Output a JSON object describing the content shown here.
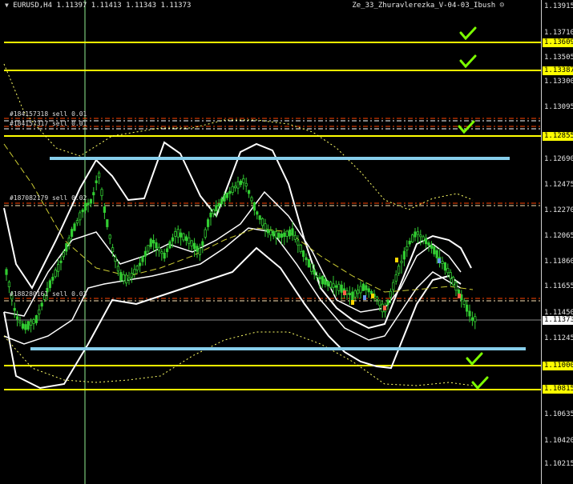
{
  "header": {
    "symbol": "EURUSD,H4",
    "quote": "1.11397 1.11413 1.11343 1.11373",
    "expert": "Ze_33_Zhuravlerezka_V-04-03_Ibush",
    "expert_icon": "smiley-icon"
  },
  "price_axis": {
    "ticks": [
      "1.13915",
      "1.13710",
      "1.13505",
      "1.13300",
      "1.13095",
      "1.12690",
      "1.12475",
      "1.12270",
      "1.12065",
      "1.11860",
      "1.11655",
      "1.11450",
      "1.11245",
      "1.10635",
      "1.10420",
      "1.10215"
    ],
    "level_tags": [
      "1.13609",
      "1.13387",
      "1.12855",
      "1.11000",
      "1.10815"
    ],
    "current_price": "1.11373"
  },
  "orders": [
    {
      "label": "#184157318 sell 0.01"
    },
    {
      "label": "#184157317 sell 0.01"
    },
    {
      "label": "#187082179 sell 0.02"
    },
    {
      "label": "#188280161 sell 0.03"
    }
  ],
  "colors": {
    "background": "#000000",
    "candles": "#32cd32",
    "levels": "#ffff00",
    "zone_lines": "#87ceeb",
    "bands": "#ffffff",
    "order_lines": "#ff4500",
    "checkmarks": "#7cfc00"
  }
}
